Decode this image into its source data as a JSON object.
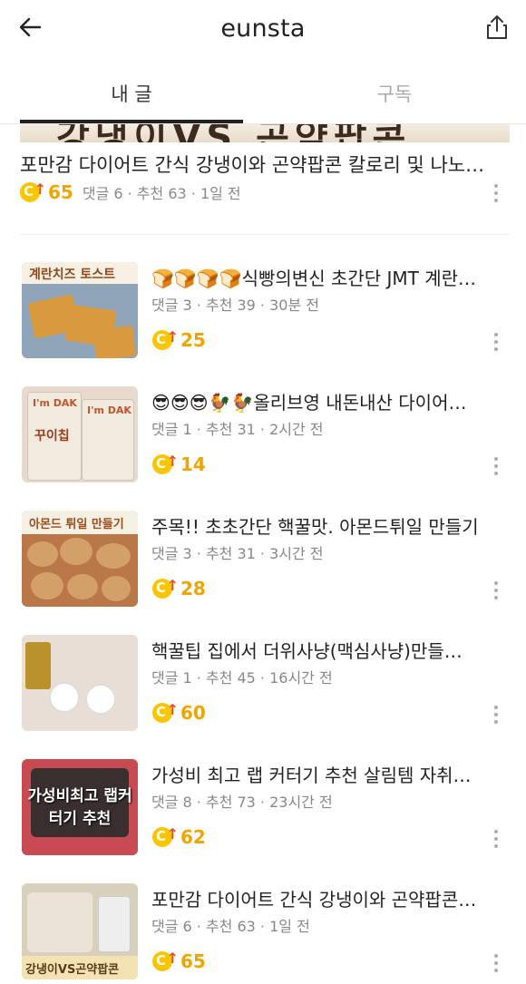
{
  "header": {
    "title": "eunsta",
    "back_icon": "back-arrow-icon",
    "share_icon": "share-icon"
  },
  "tabs": [
    {
      "label": "내 글",
      "active": true
    },
    {
      "label": "구독",
      "active": false
    }
  ],
  "featured": {
    "title": "포만감 다이어트 간식 강냉이와 곤약팝콘 칼로리 및 나노…",
    "score": "65",
    "meta": "댓글 6 · 추천 63 · 1일 전"
  },
  "posts": [
    {
      "thumb_text": "계란치즈 토스트",
      "title": "🍞🍞🍞🍞식빵의변신 초간단 JMT 계란…",
      "meta": "댓글 3 · 추천 39 · 30분 전",
      "score": "25"
    },
    {
      "thumb_text": "꾸이칩",
      "title": "😎😎😎🐓🐓올리브영 내돈내산 다이어…",
      "meta": "댓글 1 · 추천 31 · 2시간 전",
      "score": "14"
    },
    {
      "thumb_text": "아몬드 튀일 만들기",
      "title": "주목!! 초초간단 핵꿀맛. 아몬드튀일 만들기",
      "meta": "댓글 3 · 추천 31 · 3시간 전",
      "score": "28"
    },
    {
      "thumb_text": "",
      "title": "핵꿀팁 집에서 더위사냥(맥심사냥)만들…",
      "meta": "댓글 1 · 추천 45 · 16시간 전",
      "score": "60"
    },
    {
      "thumb_text": "가성비최고 랩커터기 추천",
      "title": "가성비 최고 랩 커터기 추천 살림템 자취…",
      "meta": "댓글 8 · 추천 73 · 23시간 전",
      "score": "62"
    },
    {
      "thumb_text": "강냉이VS곤약팝콘",
      "title": "포만감 다이어트 간식 강냉이와 곤약팝콘…",
      "meta": "댓글 6 · 추천 63 · 1일 전",
      "score": "65"
    }
  ],
  "colors": {
    "accent": "#f0a400",
    "badge": "#f9c400",
    "arrow": "#e84d2a",
    "muted": "#888888"
  }
}
